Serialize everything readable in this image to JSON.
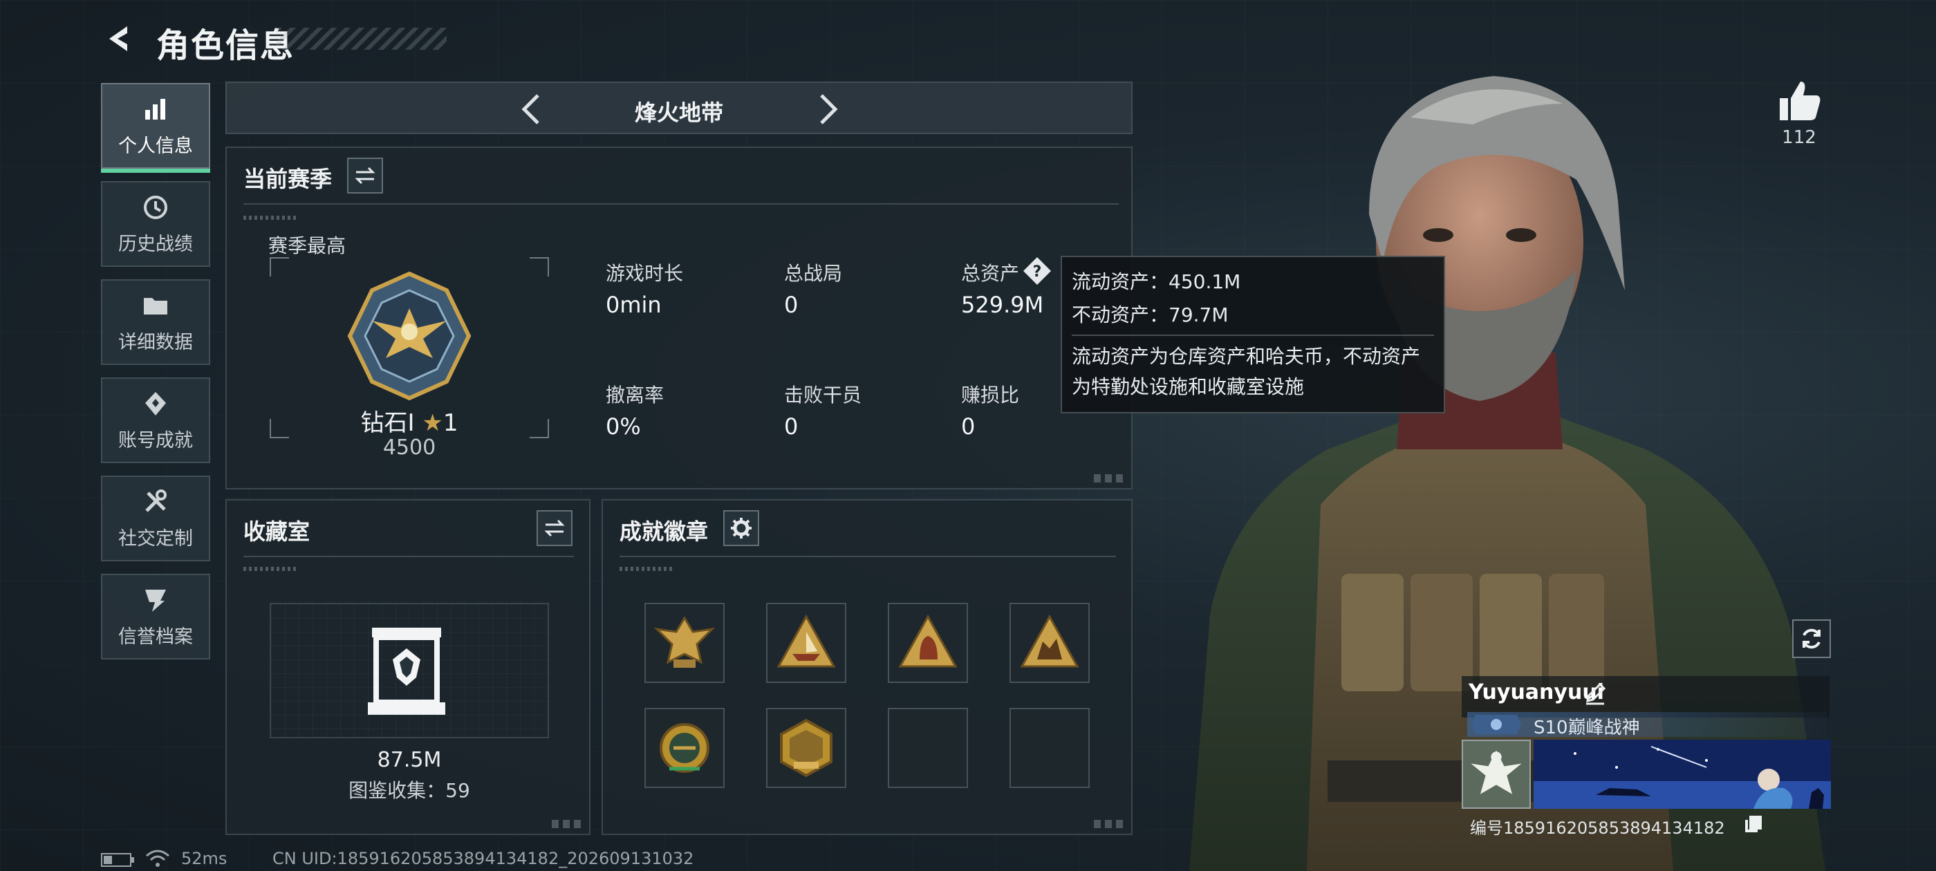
{
  "header": {
    "title": "角色信息"
  },
  "sidebar": {
    "items": [
      {
        "label": "个人信息",
        "icon": "bar-chart-icon",
        "active": true
      },
      {
        "label": "历史战绩",
        "icon": "history-icon"
      },
      {
        "label": "详细数据",
        "icon": "folder-icon"
      },
      {
        "label": "账号成就",
        "icon": "achievement-icon"
      },
      {
        "label": "社交定制",
        "icon": "tools-icon"
      },
      {
        "label": "信誉档案",
        "icon": "credit-icon"
      }
    ]
  },
  "mode": {
    "title": "烽火地带"
  },
  "season": {
    "title": "当前赛季",
    "highest_label": "赛季最高",
    "rank_name": "钻石I",
    "rank_stars": "1",
    "rank_score": "4500",
    "stats": [
      {
        "label": "游戏时长",
        "value": "0min"
      },
      {
        "label": "总战局",
        "value": "0"
      },
      {
        "label": "总资产",
        "value": "529.9M"
      },
      {
        "label": "撤离率",
        "value": "0%"
      },
      {
        "label": "击败干员",
        "value": "0"
      },
      {
        "label": "赚损比",
        "value": "0"
      }
    ]
  },
  "tooltip": {
    "liquid": "流动资产：450.1M",
    "fixed": "不动资产：79.7M",
    "desc_line1": "流动资产为仓库资产和哈夫币，不动资产",
    "desc_line2": "为特勤处设施和收藏室设施"
  },
  "collection": {
    "title": "收藏室",
    "value": "87.5M",
    "count_text": "图鉴收集：59"
  },
  "badges": {
    "title": "成就徽章",
    "slots": [
      {
        "icon": "eagle-badge-icon",
        "filled": true
      },
      {
        "icon": "triangle-ship-badge-icon",
        "filled": true
      },
      {
        "icon": "triangle-helmet-badge-icon",
        "filled": true
      },
      {
        "icon": "triangle-beast-badge-icon",
        "filled": true
      },
      {
        "icon": "round-emblem-badge-icon",
        "filled": true
      },
      {
        "icon": "hex-2026-badge-icon",
        "filled": true
      },
      {
        "icon": "",
        "filled": false
      },
      {
        "icon": "",
        "filled": false
      }
    ]
  },
  "likes": {
    "count": "112"
  },
  "profile": {
    "name": "Yuyuanyuui",
    "title": "S10巅峰战神",
    "uid_text": "编号185916205853894134182"
  },
  "status_bar": {
    "ping": "52ms",
    "cn_uid": "CN UID:185916205853894134182_202609131032"
  },
  "colors": {
    "accent": "#5fd0a0",
    "panel_bg": "#1c262c",
    "gold": "#c9a14a"
  }
}
